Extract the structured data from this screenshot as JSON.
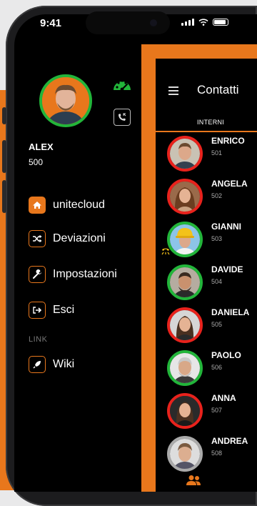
{
  "status_bar": {
    "time": "9:41"
  },
  "drawer": {
    "user_name": "ALEX",
    "user_ext": "500",
    "menu": [
      {
        "label": "unitecloud",
        "icon": "home-icon",
        "active": true
      },
      {
        "label": "Deviazioni",
        "icon": "shuffle-icon"
      },
      {
        "label": "Impostazioni",
        "icon": "wrench-icon"
      },
      {
        "label": "Esci",
        "icon": "logout-icon"
      }
    ],
    "section_label": "LINK",
    "link_item": {
      "label": "Wiki",
      "icon": "rocket-icon"
    }
  },
  "contacts": {
    "title": "Contatti",
    "tab": "INTERNI",
    "items": [
      {
        "name": "ENRICO",
        "ext": "501",
        "status": "busy"
      },
      {
        "name": "ANGELA",
        "ext": "502",
        "status": "busy"
      },
      {
        "name": "GIANNI",
        "ext": "503",
        "status": "online",
        "ringing": true
      },
      {
        "name": "DAVIDE",
        "ext": "504",
        "status": "online"
      },
      {
        "name": "DANIELA",
        "ext": "505",
        "status": "busy"
      },
      {
        "name": "PAOLO",
        "ext": "506",
        "status": "online"
      },
      {
        "name": "ANNA",
        "ext": "507",
        "status": "busy"
      },
      {
        "name": "ANDREA",
        "ext": "508",
        "status": "idle"
      }
    ]
  },
  "colors": {
    "accent": "#e8771c",
    "online": "#22b53a",
    "busy": "#e8221c"
  }
}
